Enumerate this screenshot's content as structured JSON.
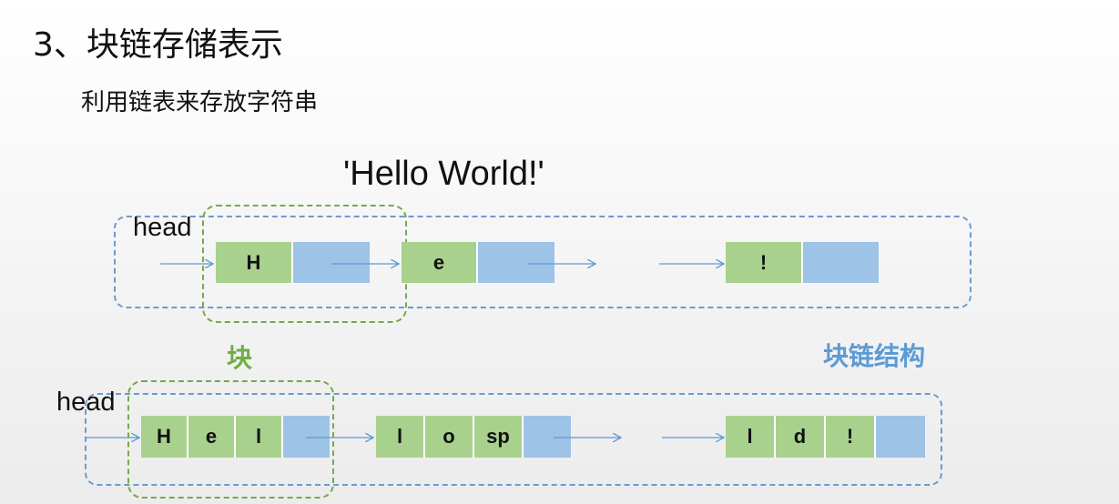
{
  "slide": {
    "title": "3、块链存储表示",
    "subtitle": "利用链表来存放字符串",
    "example_string": "'Hello World!'"
  },
  "diagram": {
    "row1": {
      "head_label": "head",
      "nodes": [
        {
          "chars": [
            "H"
          ]
        },
        {
          "chars": [
            "e"
          ]
        },
        {
          "chars": [
            "!"
          ]
        }
      ]
    },
    "row2": {
      "head_label": "head",
      "nodes": [
        {
          "chars": [
            "H",
            "e",
            "l"
          ]
        },
        {
          "chars": [
            "l",
            "o",
            "sp"
          ]
        },
        {
          "chars": [
            "l",
            "d",
            "!"
          ]
        }
      ]
    },
    "block_label": "块",
    "block_chain_label": "块链结构",
    "colors": {
      "data_cell": "#a9d18e",
      "pointer_cell": "#9dc3e6",
      "blue_dashed": "#6a9bd1",
      "green_dashed": "#78a84a",
      "block_label": "#70ad47",
      "block_chain_label": "#5b9bd5"
    }
  }
}
